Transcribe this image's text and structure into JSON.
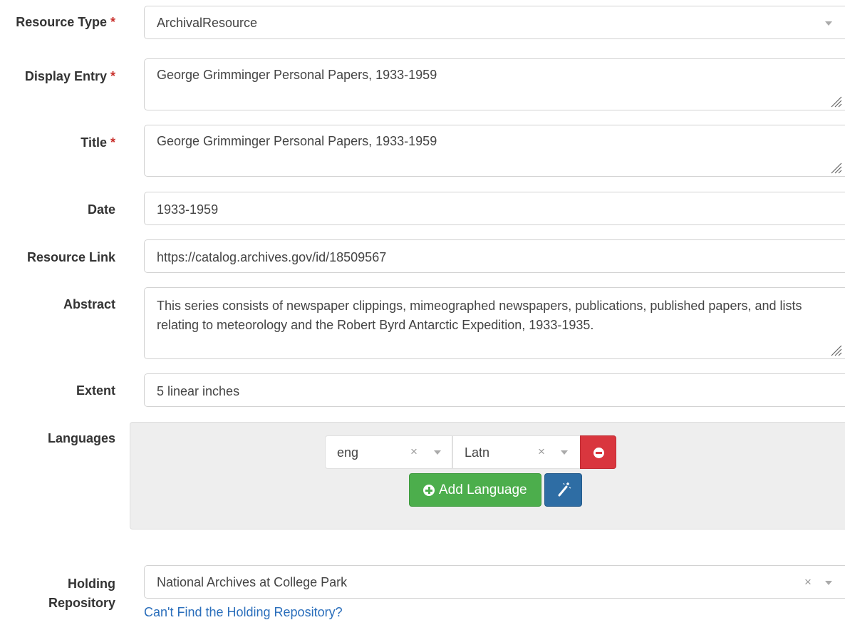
{
  "form": {
    "resource_type": {
      "label": "Resource Type",
      "required_mark": "*",
      "value": "ArchivalResource",
      "icons": [
        "chevron-down-icon"
      ]
    },
    "display_entry": {
      "label": "Display Entry",
      "required_mark": "*",
      "value": "George Grimminger Personal Papers, 1933-1959"
    },
    "title": {
      "label": "Title",
      "required_mark": "*",
      "value": "George Grimminger Personal Papers, 1933-1959"
    },
    "date": {
      "label": "Date",
      "value": "1933-1959"
    },
    "resource_link": {
      "label": "Resource Link",
      "value": "https://catalog.archives.gov/id/18509567"
    },
    "abstract": {
      "label": "Abstract",
      "value": "This series consists of newspaper clippings, mimeographed newspapers, publications, published papers, and lists relating to meteorology and the Robert Byrd Antarctic Expedition, 1933-1935."
    },
    "extent": {
      "label": "Extent",
      "value": "5 linear inches"
    },
    "languages": {
      "label": "Languages",
      "language_value": "eng",
      "script_value": "Latn",
      "add_button_label": "Add Language",
      "icons": [
        "remove-icon",
        "plus-circle-icon",
        "magic-wand-icon",
        "clear-icon",
        "chevron-down-icon"
      ],
      "colors": {
        "remove": "#d9363e",
        "add": "#4cae4c",
        "wand": "#2e6da4",
        "panel": "#eeeeee"
      }
    },
    "holding_repository": {
      "label_line1": "Holding",
      "label_line2": "Repository",
      "value": "National Archives at College Park",
      "help_link": "Can't Find the Holding Repository?"
    }
  },
  "colors": {
    "required": "#c9302c",
    "link": "#2a6ebb"
  }
}
